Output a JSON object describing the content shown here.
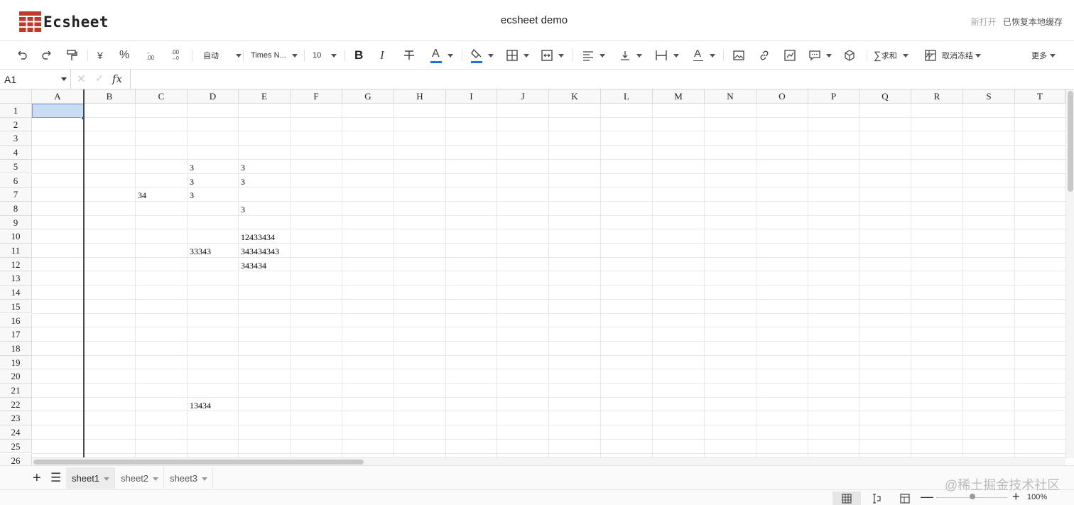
{
  "app": {
    "logo_text": "Ecsheet",
    "doc_title": "ecsheet demo",
    "new_open": "新打开",
    "restore_cache": "已恢复本地缓存",
    "brand_color": "#c0392b"
  },
  "toolbar": {
    "undo": "undo-icon",
    "redo": "redo-icon",
    "format_painter": "paint-format-icon",
    "currency": "¥",
    "percent": "%",
    "decimal_decrease": ".0",
    "decimal_increase": ".00",
    "number_format": "自动",
    "font_family": "Times N...",
    "font_size": "10",
    "bold": "B",
    "italic": "I",
    "strikethrough": "S",
    "font_color_letter": "A",
    "font_color": "#1f73d8",
    "fill_color": "#1f73d8",
    "text_rotate_letter": "A",
    "sum": "求和",
    "freeze": "取消冻结",
    "more": "更多"
  },
  "formula_bar": {
    "name_box": "A1",
    "cancel": "✕",
    "confirm": "✓",
    "fx": "fx",
    "value": ""
  },
  "grid": {
    "columns": [
      "A",
      "B",
      "C",
      "D",
      "E",
      "F",
      "G",
      "H",
      "I",
      "J",
      "K",
      "L",
      "M",
      "N",
      "O",
      "P",
      "Q",
      "R",
      "S",
      "T"
    ],
    "rows": [
      "1",
      "2",
      "3",
      "4",
      "5",
      "6",
      "7",
      "8",
      "9",
      "10",
      "11",
      "12",
      "13",
      "14",
      "15",
      "16",
      "17",
      "18",
      "19",
      "20",
      "21",
      "22",
      "23",
      "24",
      "25",
      "26"
    ],
    "cells": [
      {
        "col": "D",
        "row": 5,
        "value": "3"
      },
      {
        "col": "E",
        "row": 5,
        "value": "3"
      },
      {
        "col": "D",
        "row": 6,
        "value": "3"
      },
      {
        "col": "E",
        "row": 6,
        "value": "3"
      },
      {
        "col": "C",
        "row": 7,
        "value": "34"
      },
      {
        "col": "D",
        "row": 7,
        "value": "3"
      },
      {
        "col": "E",
        "row": 8,
        "value": "3"
      },
      {
        "col": "E",
        "row": 10,
        "value": "12433434"
      },
      {
        "col": "D",
        "row": 11,
        "value": "33343"
      },
      {
        "col": "E",
        "row": 11,
        "value": "343434343"
      },
      {
        "col": "E",
        "row": 12,
        "value": "343434"
      },
      {
        "col": "D",
        "row": 22,
        "value": "13434"
      }
    ],
    "selected_cell": "A1",
    "selection_color": "#c8dcf4"
  },
  "sheets": {
    "add": "+",
    "list": "☰",
    "tabs": [
      {
        "name": "sheet1",
        "active": true
      },
      {
        "name": "sheet2",
        "active": false
      },
      {
        "name": "sheet3",
        "active": false
      }
    ]
  },
  "status": {
    "zoom": "100%",
    "zoom_minus": "—",
    "zoom_plus": "+"
  },
  "watermark": "@稀土掘金技术社区"
}
